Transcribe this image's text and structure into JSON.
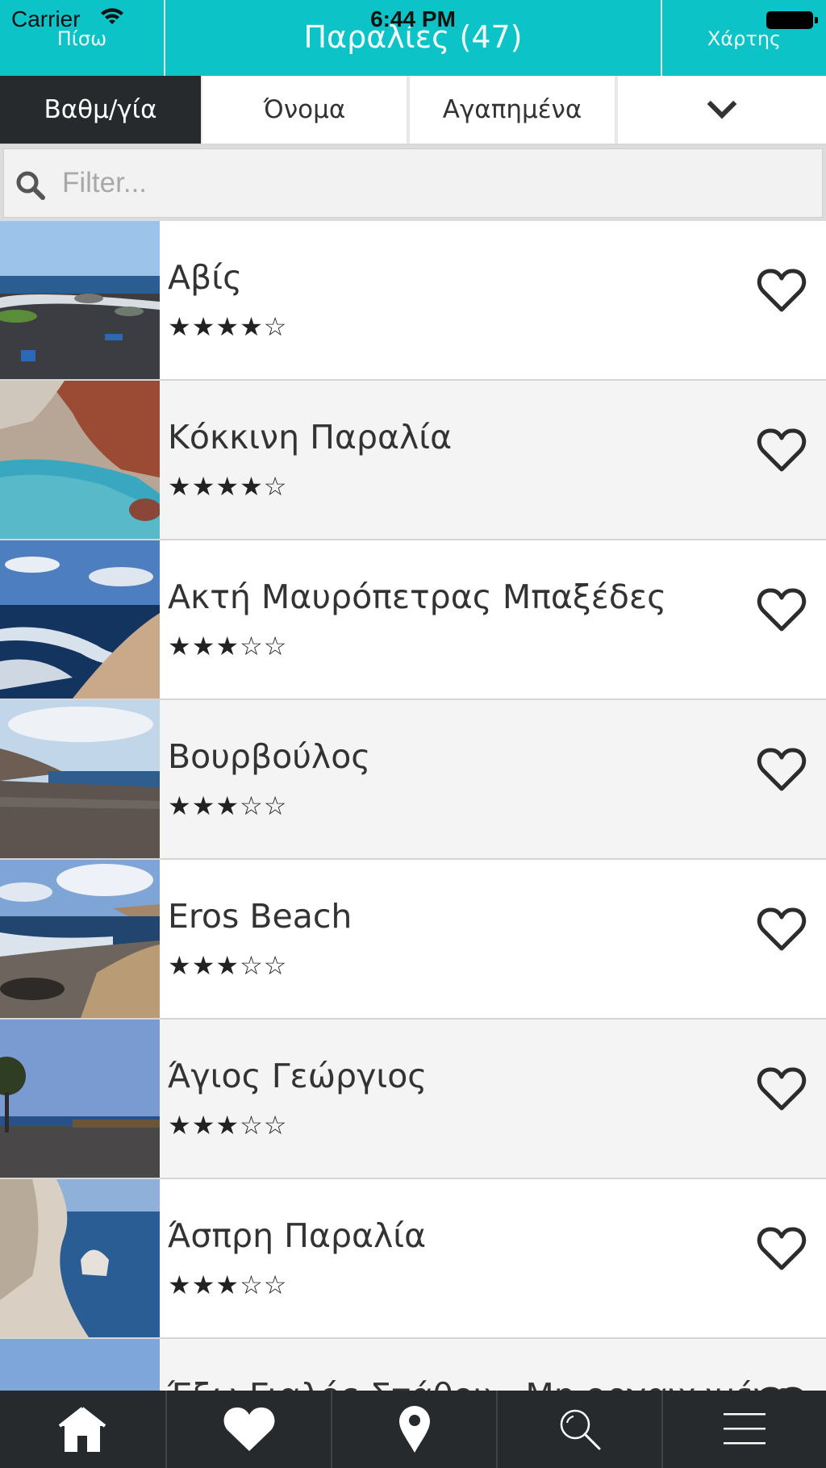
{
  "status_bar": {
    "carrier": "Carrier",
    "time": "6:44 PM"
  },
  "navbar": {
    "back_label": "Πίσω",
    "title": "Παραλίες (47)",
    "map_label": "Χάρτης"
  },
  "sort_tabs": [
    {
      "label": "Βαθμ/γία",
      "active": true
    },
    {
      "label": "Όνομα",
      "active": false
    },
    {
      "label": "Αγαπημένα",
      "active": false
    }
  ],
  "filter": {
    "placeholder": "Filter..."
  },
  "beaches": [
    {
      "name": "Αβίς",
      "stars": "★★★★☆",
      "rating": 4
    },
    {
      "name": "Κόκκινη Παραλία",
      "stars": "★★★★☆",
      "rating": 4
    },
    {
      "name": "Ακτή Μαυρόπετρας Μπαξέδες",
      "stars": "★★★☆☆",
      "rating": 3
    },
    {
      "name": "Βουρβούλος",
      "stars": "★★★☆☆",
      "rating": 3
    },
    {
      "name": "Eros Beach",
      "stars": "★★★☆☆",
      "rating": 3
    },
    {
      "name": "Άγιος Γεώργιος",
      "stars": "★★★☆☆",
      "rating": 3
    },
    {
      "name": "Άσπρη Παραλία",
      "stars": "★★★☆☆",
      "rating": 3
    },
    {
      "name": "Έξω Γιαλός Στάθου - Μη οργανωμένη",
      "stars": "",
      "rating": null
    }
  ],
  "tabbar": [
    "home-icon",
    "heart-icon",
    "map-pin-icon",
    "search-icon",
    "menu-icon"
  ],
  "colors": {
    "accent": "#0cc3c8",
    "dark": "#262a2c"
  }
}
